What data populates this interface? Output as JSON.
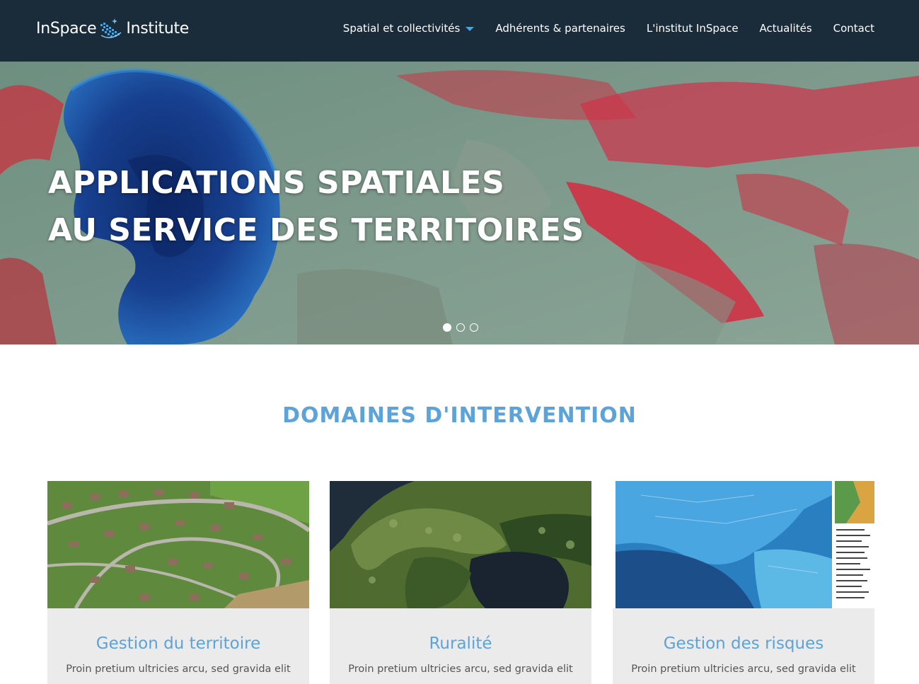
{
  "brand": {
    "name_left": "InSpace",
    "name_right": "Institute"
  },
  "nav": {
    "items": [
      {
        "label": "Spatial et collectivités",
        "has_dropdown": true
      },
      {
        "label": "Adhérents & partenaires"
      },
      {
        "label": "L'institut InSpace"
      },
      {
        "label": "Actualités"
      },
      {
        "label": "Contact"
      }
    ]
  },
  "hero": {
    "line1": "APPLICATIONS SPATIALES",
    "line2": "AU SERVICE DES TERRITOIRES",
    "slides": 3,
    "active_slide": 1
  },
  "section": {
    "title": "DOMAINES D'INTERVENTION"
  },
  "cards": [
    {
      "title": "Gestion du territoire",
      "text": "Proin pretium ultricies arcu, sed gravida elit"
    },
    {
      "title": "Ruralité",
      "text": "Proin pretium ultricies arcu, sed gravida elit"
    },
    {
      "title": "Gestion des risques",
      "text": "Proin pretium ultricies arcu, sed gravida elit"
    }
  ],
  "colors": {
    "header_bg": "#1a2b3a",
    "accent": "#5ba3d9",
    "caret": "#4aa3df",
    "card_bg": "#ebebeb"
  }
}
